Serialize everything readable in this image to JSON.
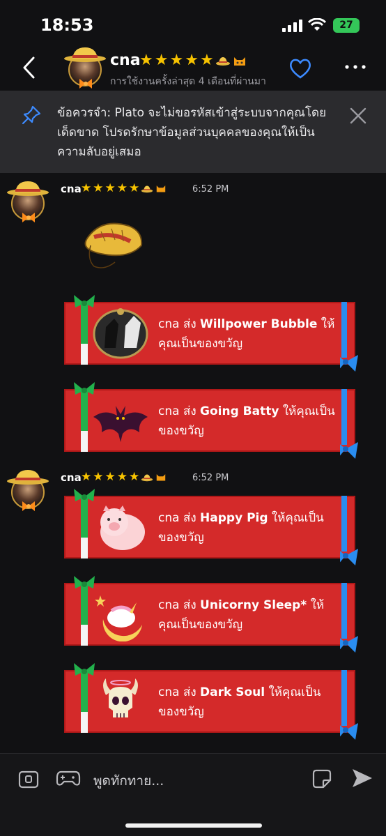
{
  "status_bar": {
    "time": "18:53",
    "battery": "27"
  },
  "header": {
    "name": "cna",
    "last_active": "การใช้งานครั้งล่าสุด 4 เดือนที่ผ่านมา"
  },
  "banner": {
    "text": "ข้อควรจำ: Plato จะไม่ขอรหัสเข้าสู่ระบบจากคุณโดยเด็ดขาด โปรดรักษาข้อมูลส่วนบุคคลของคุณให้เป็นความลับอยู่เสมอ"
  },
  "messages": [
    {
      "sender": "cna",
      "time": "6:52 PM"
    },
    {
      "sender": "cna",
      "time": "6:52 PM"
    }
  ],
  "gifts": [
    {
      "prefix": "cna ส่ง ",
      "name": "Willpower Bubble",
      "suffix": " ให้คุณเป็นของขวัญ",
      "icon": "knight-horse-icon"
    },
    {
      "prefix": "cna ส่ง ",
      "name": "Going Batty",
      "suffix": " ให้คุณเป็นของขวัญ",
      "icon": "bat-icon"
    },
    {
      "prefix": "cna ส่ง ",
      "name": "Happy Pig",
      "suffix": " ให้คุณเป็นของขวัญ",
      "icon": "pig-icon"
    },
    {
      "prefix": "cna ส่ง ",
      "name": "Unicorny Sleep*",
      "suffix": " ให้คุณเป็นของขวัญ",
      "icon": "sleeping-unicorn-icon"
    },
    {
      "prefix": "cna ส่ง ",
      "name": "Dark Soul",
      "suffix": " ให้คุณเป็นของขวัญ",
      "icon": "horned-skull-icon"
    }
  ],
  "input": {
    "placeholder": "พูดทักทาย..."
  },
  "colors": {
    "gift_red": "#d42a2a",
    "ribbon_green": "#22b14c",
    "ribbon_blue": "#2a8df0",
    "star": "#f7c300"
  }
}
